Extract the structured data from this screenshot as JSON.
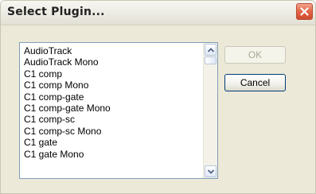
{
  "window": {
    "title": "Select Plugin..."
  },
  "plugins": {
    "items": [
      "AudioTrack",
      "AudioTrack Mono",
      "C1 comp",
      "C1 comp Mono",
      "C1 comp-gate",
      "C1 comp-gate Mono",
      "C1 comp-sc",
      "C1 comp-sc Mono",
      "C1 gate",
      "C1 gate Mono"
    ]
  },
  "buttons": {
    "ok_label": "OK",
    "ok_enabled": false,
    "cancel_label": "Cancel"
  },
  "icons": {
    "close": "close-icon",
    "scroll_up": "arrow-up-icon",
    "scroll_down": "arrow-down-icon"
  },
  "colors": {
    "dialog_bg": "#ece9d8",
    "close_button": "#e4684a",
    "list_border": "#7f9db9"
  }
}
